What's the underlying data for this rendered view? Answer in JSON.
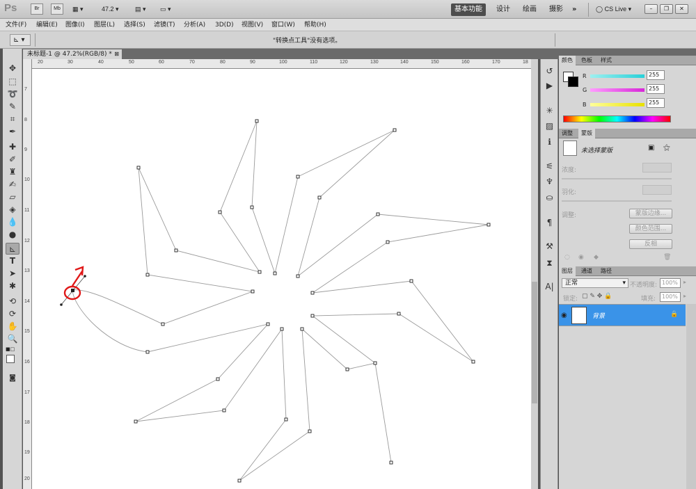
{
  "app": {
    "logo": "Ps",
    "zoom": "47.2",
    "btn_br": "Br",
    "btn_mb": "Mb"
  },
  "workspace": {
    "items": [
      "基本功能",
      "设计",
      "绘画",
      "摄影"
    ],
    "more": "»",
    "cs_live": "CS Live"
  },
  "menu": {
    "items": [
      "文件(F)",
      "编辑(E)",
      "图像(I)",
      "图层(L)",
      "选择(S)",
      "滤镜(T)",
      "分析(A)",
      "3D(D)",
      "视图(V)",
      "窗口(W)",
      "帮助(H)"
    ]
  },
  "options": {
    "message": "\"转换点工具\"没有选项。"
  },
  "document": {
    "tab_title": "未标题-1 @ 47.2%(RGB/8) *",
    "ruler_h": [
      "20",
      "30",
      "40",
      "50",
      "60",
      "70",
      "80",
      "90",
      "100",
      "110",
      "120",
      "130",
      "140",
      "150",
      "160",
      "170",
      "18"
    ],
    "ruler_v": [
      "7",
      "8",
      "9",
      "10",
      "11",
      "12",
      "13",
      "14",
      "15",
      "16",
      "17",
      "18",
      "19",
      "20"
    ]
  },
  "color_panel": {
    "tabs": [
      "颜色",
      "色板",
      "样式"
    ],
    "channels": [
      {
        "label": "R",
        "value": "255",
        "gradient": [
          "#9ef0f0",
          "#28d0d8"
        ]
      },
      {
        "label": "G",
        "value": "255",
        "gradient": [
          "#ff9cff",
          "#d826d8"
        ]
      },
      {
        "label": "B",
        "value": "255",
        "gradient": [
          "#ffff9a",
          "#e8e000"
        ]
      }
    ]
  },
  "masks_panel": {
    "tabs": [
      "调整",
      "蒙版"
    ],
    "no_mask": "未选择蒙版",
    "density": "浓度:",
    "feather": "羽化:",
    "refine": "调整:",
    "btn_edge": "蒙版边缘...",
    "btn_color_range": "颜色范围...",
    "btn_invert": "反相"
  },
  "layers_panel": {
    "tabs": [
      "图层",
      "通道",
      "路径"
    ],
    "blend_mode": "正常",
    "opacity_label": "不透明度:",
    "opacity_value": "100%",
    "lock_label": "锁定:",
    "fill_label": "填充:",
    "fill_value": "100%",
    "layer_name": "背景",
    "selected_color": "#3a93e8"
  },
  "colors": {
    "accent": "#3a93e8"
  }
}
